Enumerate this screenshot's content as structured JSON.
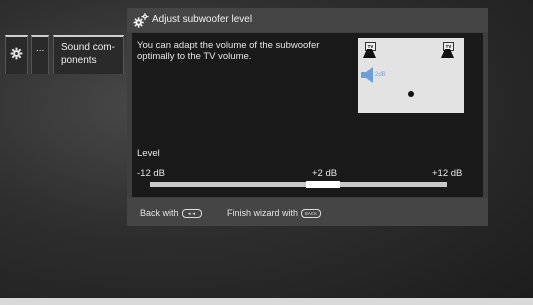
{
  "menu": {
    "settings_icon": "gear-icon",
    "more_label": "...",
    "sound_components_label": "Sound com- ponents"
  },
  "dialog": {
    "icon": "gears-icon",
    "title": "Adjust subwoofer level",
    "description": "You can adapt the volume of the subwoofer optimally to the TV volume.",
    "room": {
      "speaker_label": "TV",
      "subwoofer_level": "2dB",
      "accent_color": "#6f9fd8"
    },
    "level": {
      "label": "Level",
      "min_label": "-12 dB",
      "current_label": "+2 dB",
      "max_label": "+12 dB",
      "min": -12,
      "max": 12,
      "value": 2
    },
    "footer": {
      "back_text": "Back with",
      "back_key": "◄◄",
      "finish_text": "Finish wizard with",
      "finish_key": "BACK"
    }
  }
}
